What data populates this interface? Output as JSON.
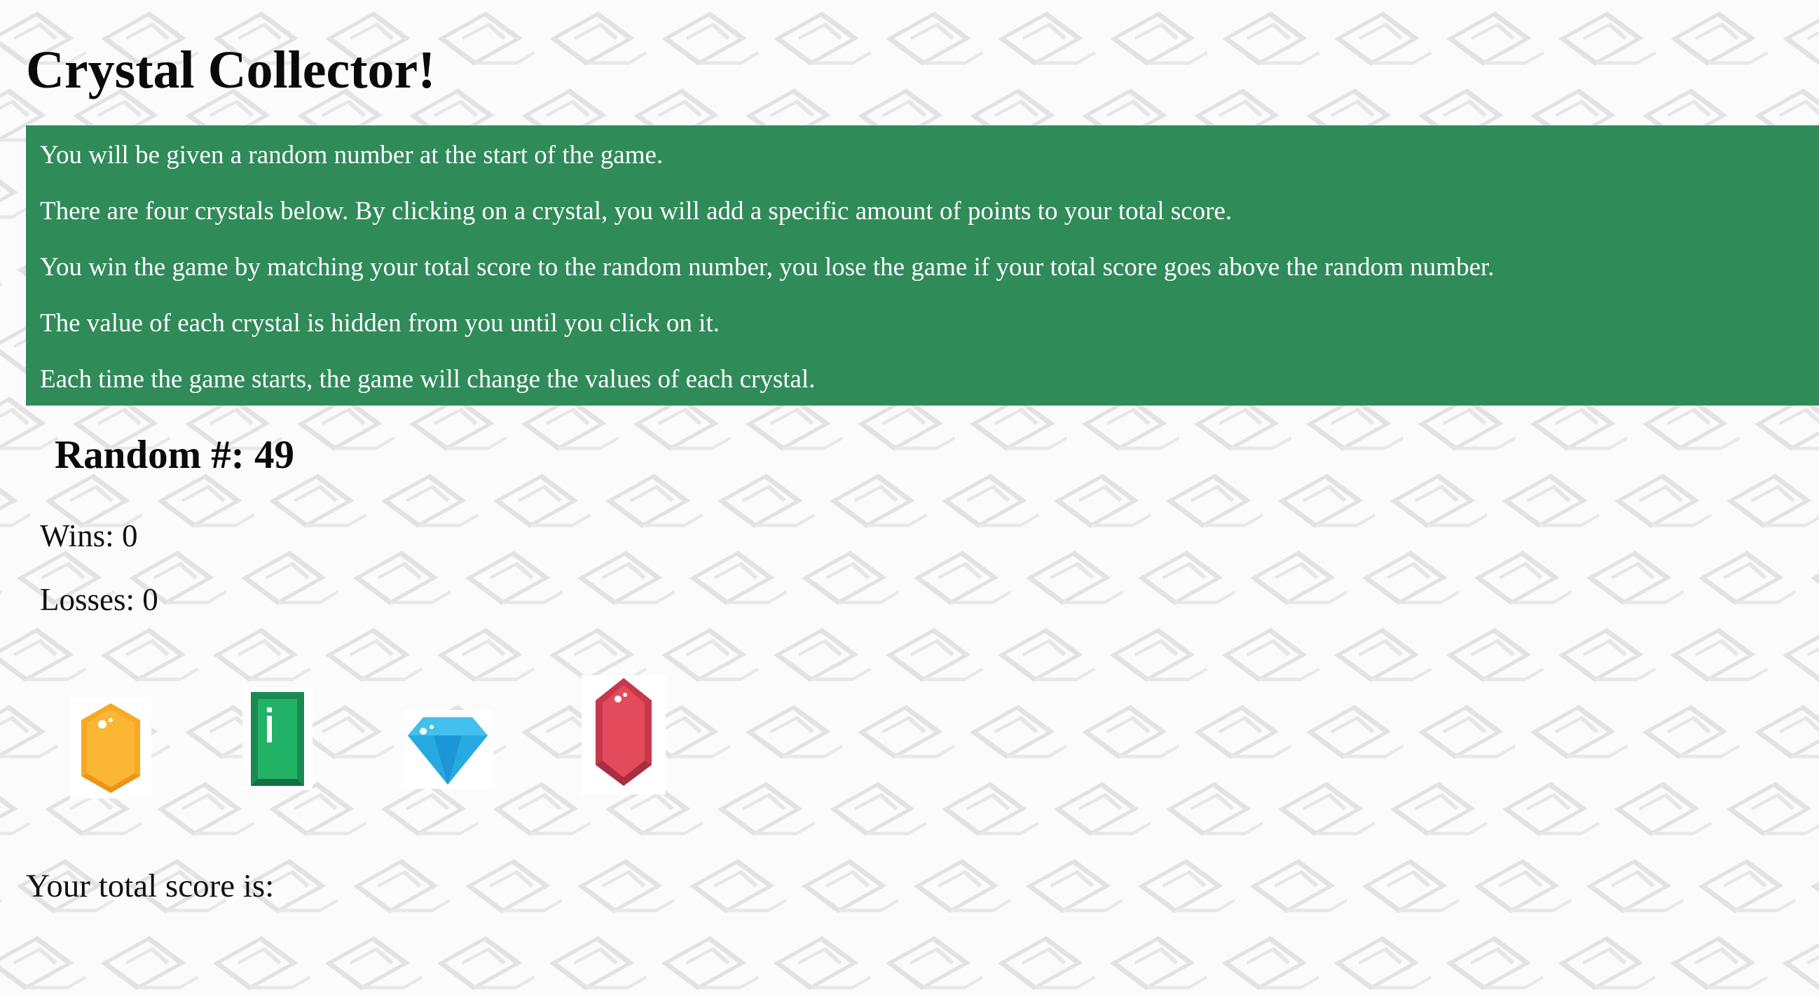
{
  "title": "Crystal Collector!",
  "instructions": [
    "You will be given a random number at the start of the game.",
    "There are four crystals below. By clicking on a crystal, you will add a specific amount of points to your total score.",
    "You win the game by matching your total score to the random number, you lose the game if your total score goes above the random number.",
    "The value of each crystal is hidden from you until you click on it.",
    "Each time the game starts, the game will change the values of each crystal."
  ],
  "random_label": "Random #: 49",
  "random_number": 49,
  "wins_label": "Wins: 0",
  "wins": 0,
  "losses_label": "Losses: 0",
  "losses": 0,
  "crystals": [
    {
      "icon": "yellow-gem-icon",
      "color": "#fbb733"
    },
    {
      "icon": "green-emerald-icon",
      "color": "#22b266"
    },
    {
      "icon": "blue-diamond-icon",
      "color": "#26aae1"
    },
    {
      "icon": "red-ruby-icon",
      "color": "#e34a5c"
    }
  ],
  "score_label": "Your total score is:",
  "colors": {
    "instructions_bg": "#2f8b58",
    "instructions_text": "#ffffff",
    "page_bg": "#fbfbfb",
    "pattern_stroke": "#e2e2e2"
  }
}
